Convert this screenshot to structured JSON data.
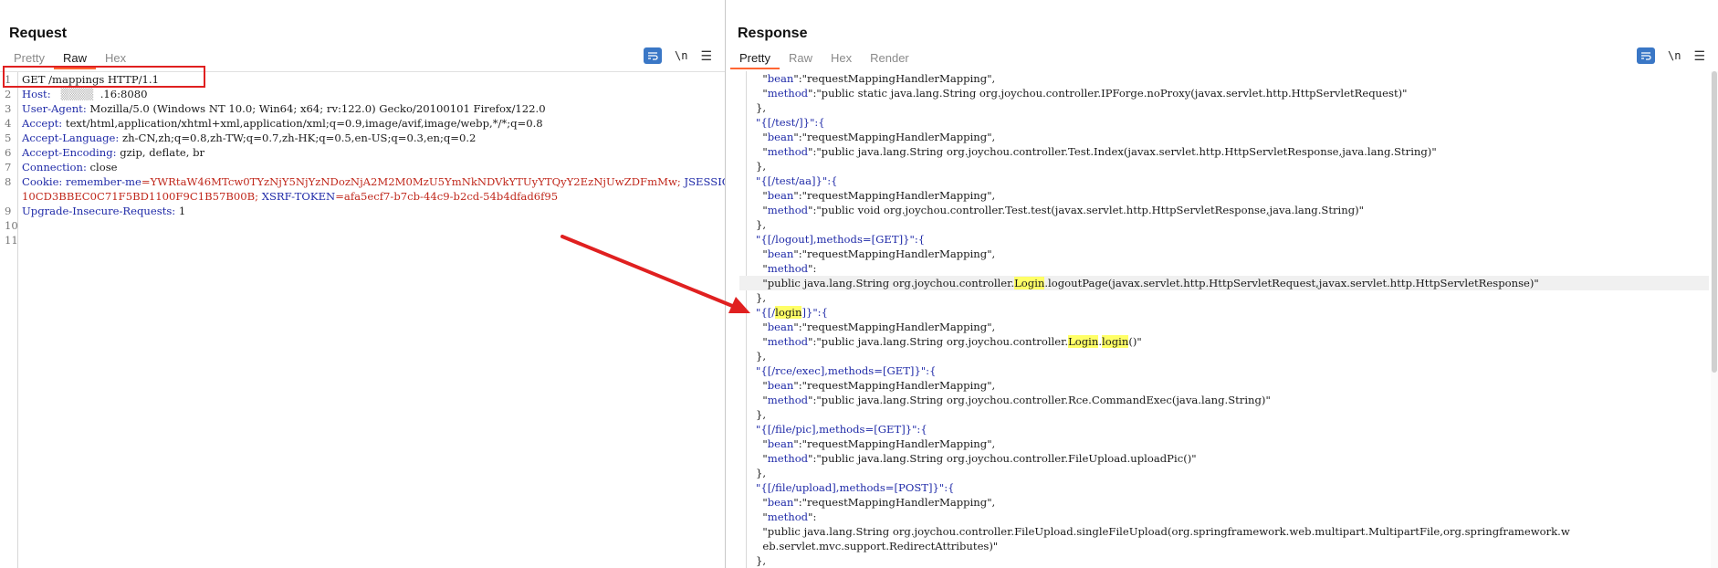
{
  "layout_switch": {
    "items": [
      "split-horizontal",
      "split-vertical",
      "single"
    ]
  },
  "request": {
    "title": "Request",
    "tabs": [
      "Pretty",
      "Raw",
      "Hex"
    ],
    "active_tab": "Raw",
    "tools": {
      "wrap_icon": "wrap-lines-icon",
      "newline_label": "\\n",
      "menu_icon": "menu-icon"
    },
    "line_numbers": [
      "1",
      "2",
      "3",
      "4",
      "5",
      "6",
      "7",
      "8",
      "",
      "9",
      "10",
      "11"
    ],
    "lines": [
      {
        "parts": [
          {
            "t": "GET /mappings HTTP/1.1",
            "c": ""
          }
        ]
      },
      {
        "parts": [
          {
            "t": "Host: ",
            "c": "k"
          },
          {
            "t": "  ▒▒▒▒  ",
            "c": "blur"
          },
          {
            "t": ".16:8080",
            "c": ""
          }
        ]
      },
      {
        "parts": [
          {
            "t": "User-Agent: ",
            "c": "k"
          },
          {
            "t": "Mozilla/5.0 (Windows NT 10.0; Win64; x64; rv:122.0) Gecko/20100101 Firefox/122.0",
            "c": ""
          }
        ]
      },
      {
        "parts": [
          {
            "t": "Accept: ",
            "c": "k"
          },
          {
            "t": "text/html,application/xhtml+xml,application/xml;q=0.9,image/avif,image/webp,*/*;q=0.8",
            "c": ""
          }
        ]
      },
      {
        "parts": [
          {
            "t": "Accept-Language: ",
            "c": "k"
          },
          {
            "t": "zh-CN,zh;q=0.8,zh-TW;q=0.7,zh-HK;q=0.5,en-US;q=0.3,en;q=0.2",
            "c": ""
          }
        ]
      },
      {
        "parts": [
          {
            "t": "Accept-Encoding: ",
            "c": "k"
          },
          {
            "t": "gzip, deflate, br",
            "c": ""
          }
        ]
      },
      {
        "parts": [
          {
            "t": "Connection: ",
            "c": "k"
          },
          {
            "t": "close",
            "c": ""
          }
        ]
      },
      {
        "parts": [
          {
            "t": "Cookie: ",
            "c": "k"
          },
          {
            "t": "remember-me",
            "c": "k"
          },
          {
            "t": "=YWRtaW46MTcw0TYzNjY5NjYzNDozNjA2M2M0MzU5YmNkNDVkYTUyYTQyY2EzNjUwZDFmMw; ",
            "c": "v"
          },
          {
            "t": "JSESSIONID",
            "c": "k"
          },
          {
            "t": "=",
            "c": "v"
          }
        ]
      },
      {
        "parts": [
          {
            "t": "10CD3BBEC0C71F5BD1100F9C1B57B00B; ",
            "c": "v"
          },
          {
            "t": "XSRF-TOKEN",
            "c": "k"
          },
          {
            "t": "=afa5ecf7-b7cb-44c9-b2cd-54b4dfad6f95",
            "c": "v"
          }
        ]
      },
      {
        "parts": [
          {
            "t": "Upgrade-Insecure-Requests: ",
            "c": "k"
          },
          {
            "t": "1",
            "c": ""
          }
        ]
      },
      {
        "parts": [
          {
            "t": "",
            "c": ""
          }
        ]
      },
      {
        "parts": [
          {
            "t": "",
            "c": ""
          }
        ]
      }
    ]
  },
  "response": {
    "title": "Response",
    "tabs": [
      "Pretty",
      "Raw",
      "Hex",
      "Render"
    ],
    "active_tab": "Pretty",
    "tools": {
      "wrap_icon": "wrap-lines-icon",
      "newline_label": "\\n",
      "menu_icon": "menu-icon"
    },
    "lines": [
      {
        "hl": false,
        "parts": [
          {
            "t": "  \"",
            "c": ""
          },
          {
            "t": "bean",
            "c": "jk"
          },
          {
            "t": "\":\"requestMappingHandlerMapping\",",
            "c": ""
          }
        ]
      },
      {
        "hl": false,
        "parts": [
          {
            "t": "  \"",
            "c": ""
          },
          {
            "t": "method",
            "c": "jk"
          },
          {
            "t": "\":\"public static java.lang.String org.joychou.controller.IPForge.noProxy(javax.servlet.http.HttpServletRequest)\"",
            "c": ""
          }
        ]
      },
      {
        "hl": false,
        "parts": [
          {
            "t": "},",
            "c": ""
          }
        ]
      },
      {
        "hl": false,
        "parts": [
          {
            "t": "\"{[/test/]}\":{",
            "c": "jk"
          }
        ]
      },
      {
        "hl": false,
        "parts": [
          {
            "t": "  \"",
            "c": ""
          },
          {
            "t": "bean",
            "c": "jk"
          },
          {
            "t": "\":\"requestMappingHandlerMapping\",",
            "c": ""
          }
        ]
      },
      {
        "hl": false,
        "parts": [
          {
            "t": "  \"",
            "c": ""
          },
          {
            "t": "method",
            "c": "jk"
          },
          {
            "t": "\":\"public java.lang.String org.joychou.controller.Test.Index(javax.servlet.http.HttpServletResponse,java.lang.String)\"",
            "c": ""
          }
        ]
      },
      {
        "hl": false,
        "parts": [
          {
            "t": "},",
            "c": ""
          }
        ]
      },
      {
        "hl": false,
        "parts": [
          {
            "t": "\"{[/test/aa]}\":{",
            "c": "jk"
          }
        ]
      },
      {
        "hl": false,
        "parts": [
          {
            "t": "  \"",
            "c": ""
          },
          {
            "t": "bean",
            "c": "jk"
          },
          {
            "t": "\":\"requestMappingHandlerMapping\",",
            "c": ""
          }
        ]
      },
      {
        "hl": false,
        "parts": [
          {
            "t": "  \"",
            "c": ""
          },
          {
            "t": "method",
            "c": "jk"
          },
          {
            "t": "\":\"public void org.joychou.controller.Test.test(javax.servlet.http.HttpServletResponse,java.lang.String)\"",
            "c": ""
          }
        ]
      },
      {
        "hl": false,
        "parts": [
          {
            "t": "},",
            "c": ""
          }
        ]
      },
      {
        "hl": false,
        "parts": [
          {
            "t": "\"{[/logout],methods=[GET]}\":{",
            "c": "jk"
          }
        ]
      },
      {
        "hl": false,
        "parts": [
          {
            "t": "  \"",
            "c": ""
          },
          {
            "t": "bean",
            "c": "jk"
          },
          {
            "t": "\":\"requestMappingHandlerMapping\",",
            "c": ""
          }
        ]
      },
      {
        "hl": false,
        "parts": [
          {
            "t": "  \"",
            "c": ""
          },
          {
            "t": "method",
            "c": "jk"
          },
          {
            "t": "\":",
            "c": ""
          }
        ]
      },
      {
        "hl": true,
        "parts": [
          {
            "t": "  \"public java.lang.String org.joychou.controller.",
            "c": ""
          },
          {
            "t": "Login",
            "c": "mark"
          },
          {
            "t": ".logoutPage(javax.servlet.http.HttpServletRequest,javax.servlet.http.HttpServletResponse)\"",
            "c": ""
          }
        ]
      },
      {
        "hl": false,
        "parts": [
          {
            "t": "},",
            "c": ""
          }
        ]
      },
      {
        "hl": false,
        "parts": [
          {
            "t": "\"{[/",
            "c": "jk"
          },
          {
            "t": "login",
            "c": "mark"
          },
          {
            "t": "]}\":{",
            "c": "jk"
          }
        ]
      },
      {
        "hl": false,
        "parts": [
          {
            "t": "  \"",
            "c": ""
          },
          {
            "t": "bean",
            "c": "jk"
          },
          {
            "t": "\":\"requestMappingHandlerMapping\",",
            "c": ""
          }
        ]
      },
      {
        "hl": false,
        "parts": [
          {
            "t": "  \"",
            "c": ""
          },
          {
            "t": "method",
            "c": "jk"
          },
          {
            "t": "\":\"public java.lang.String org.joychou.controller.",
            "c": ""
          },
          {
            "t": "Login",
            "c": "mark"
          },
          {
            "t": ".",
            "c": ""
          },
          {
            "t": "login",
            "c": "mark"
          },
          {
            "t": "()\"",
            "c": ""
          }
        ]
      },
      {
        "hl": false,
        "parts": [
          {
            "t": "},",
            "c": ""
          }
        ]
      },
      {
        "hl": false,
        "parts": [
          {
            "t": "\"{[/rce/exec],methods=[GET]}\":{",
            "c": "jk"
          }
        ]
      },
      {
        "hl": false,
        "parts": [
          {
            "t": "  \"",
            "c": ""
          },
          {
            "t": "bean",
            "c": "jk"
          },
          {
            "t": "\":\"requestMappingHandlerMapping\",",
            "c": ""
          }
        ]
      },
      {
        "hl": false,
        "parts": [
          {
            "t": "  \"",
            "c": ""
          },
          {
            "t": "method",
            "c": "jk"
          },
          {
            "t": "\":\"public java.lang.String org.joychou.controller.Rce.CommandExec(java.lang.String)\"",
            "c": ""
          }
        ]
      },
      {
        "hl": false,
        "parts": [
          {
            "t": "},",
            "c": ""
          }
        ]
      },
      {
        "hl": false,
        "parts": [
          {
            "t": "\"{[/file/pic],methods=[GET]}\":{",
            "c": "jk"
          }
        ]
      },
      {
        "hl": false,
        "parts": [
          {
            "t": "  \"",
            "c": ""
          },
          {
            "t": "bean",
            "c": "jk"
          },
          {
            "t": "\":\"requestMappingHandlerMapping\",",
            "c": ""
          }
        ]
      },
      {
        "hl": false,
        "parts": [
          {
            "t": "  \"",
            "c": ""
          },
          {
            "t": "method",
            "c": "jk"
          },
          {
            "t": "\":\"public java.lang.String org.joychou.controller.FileUpload.uploadPic()\"",
            "c": ""
          }
        ]
      },
      {
        "hl": false,
        "parts": [
          {
            "t": "},",
            "c": ""
          }
        ]
      },
      {
        "hl": false,
        "parts": [
          {
            "t": "\"{[/file/upload],methods=[POST]}\":{",
            "c": "jk"
          }
        ]
      },
      {
        "hl": false,
        "parts": [
          {
            "t": "  \"",
            "c": ""
          },
          {
            "t": "bean",
            "c": "jk"
          },
          {
            "t": "\":\"requestMappingHandlerMapping\",",
            "c": ""
          }
        ]
      },
      {
        "hl": false,
        "parts": [
          {
            "t": "  \"",
            "c": ""
          },
          {
            "t": "method",
            "c": "jk"
          },
          {
            "t": "\":",
            "c": ""
          }
        ]
      },
      {
        "hl": false,
        "parts": [
          {
            "t": "  \"public java.lang.String org.joychou.controller.FileUpload.singleFileUpload(org.springframework.web.multipart.MultipartFile,org.springframework.w",
            "c": ""
          }
        ]
      },
      {
        "hl": false,
        "parts": [
          {
            "t": "  eb.servlet.mvc.support.RedirectAttributes)\"",
            "c": ""
          }
        ]
      },
      {
        "hl": false,
        "parts": [
          {
            "t": "},",
            "c": ""
          }
        ]
      }
    ]
  },
  "annotation": {
    "color": "#e02020"
  }
}
